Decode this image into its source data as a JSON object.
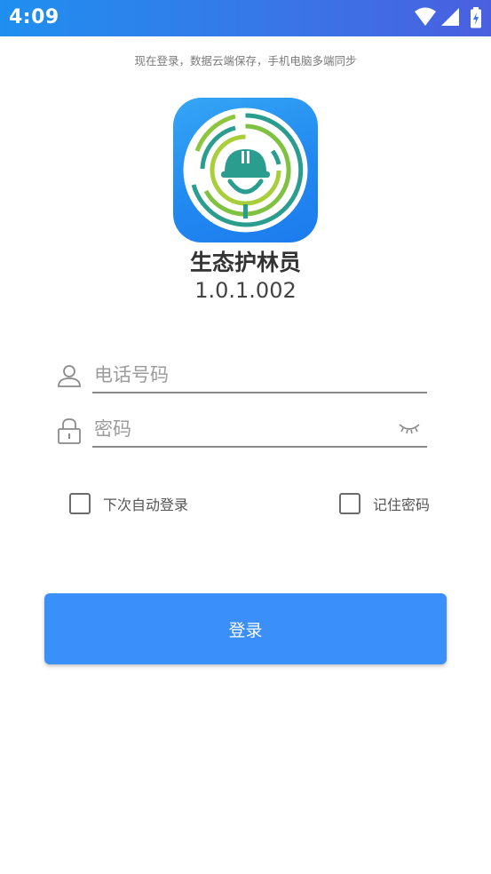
{
  "status_bar": {
    "time": "4:09"
  },
  "header": {
    "hint": "现在登录，数据云端保存，手机电脑多端同步"
  },
  "app": {
    "name": "生态护林员",
    "version": "1.0.1.002"
  },
  "form": {
    "phone_placeholder": "电话号码",
    "phone_value": "",
    "password_placeholder": "密码",
    "password_value": "",
    "auto_login_label": "下次自动登录",
    "remember_password_label": "记住密码",
    "login_label": "登录"
  },
  "colors": {
    "accent": "#3a8ffb",
    "status_bar": "#3a74e6",
    "logo_green": "#8cc63f",
    "logo_teal": "#2a9d8f"
  }
}
